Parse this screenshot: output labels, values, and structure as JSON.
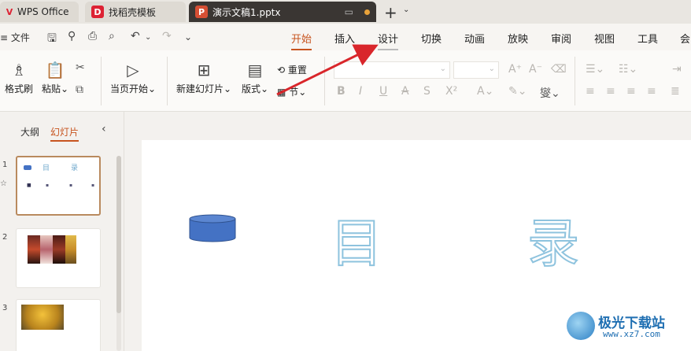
{
  "tabs": [
    {
      "label": "WPS Office",
      "icon": "wps-logo-icon"
    },
    {
      "label": "找稻壳模板",
      "icon": "docer-icon"
    },
    {
      "label": "演示文稿1.pptx",
      "icon": "presentation-icon"
    }
  ],
  "menu": {
    "file": "文件",
    "tabs": [
      "开始",
      "插入",
      "设计",
      "切换",
      "动画",
      "放映",
      "审阅",
      "视图",
      "工具",
      "会"
    ]
  },
  "ribbon": {
    "format_painter": "格式刷",
    "paste": "粘贴",
    "play_current": "当页开始",
    "new_slide": "新建幻灯片",
    "layout": "版式",
    "reset": "重置",
    "section": "节"
  },
  "panel": {
    "tab_outline": "大纲",
    "tab_slides": "幻灯片",
    "slide_numbers": [
      "1",
      "2",
      "3"
    ]
  },
  "slide": {
    "char1": "目",
    "char2": "录",
    "thumb_chars": [
      "目",
      "录"
    ]
  },
  "watermark": {
    "name": "极光下载站",
    "url": "www.xz7.com"
  },
  "colors": {
    "accent": "#c7541f",
    "active_tab": "#3a3633",
    "shape_fill": "#4472c4",
    "arrow": "#d9262b"
  }
}
